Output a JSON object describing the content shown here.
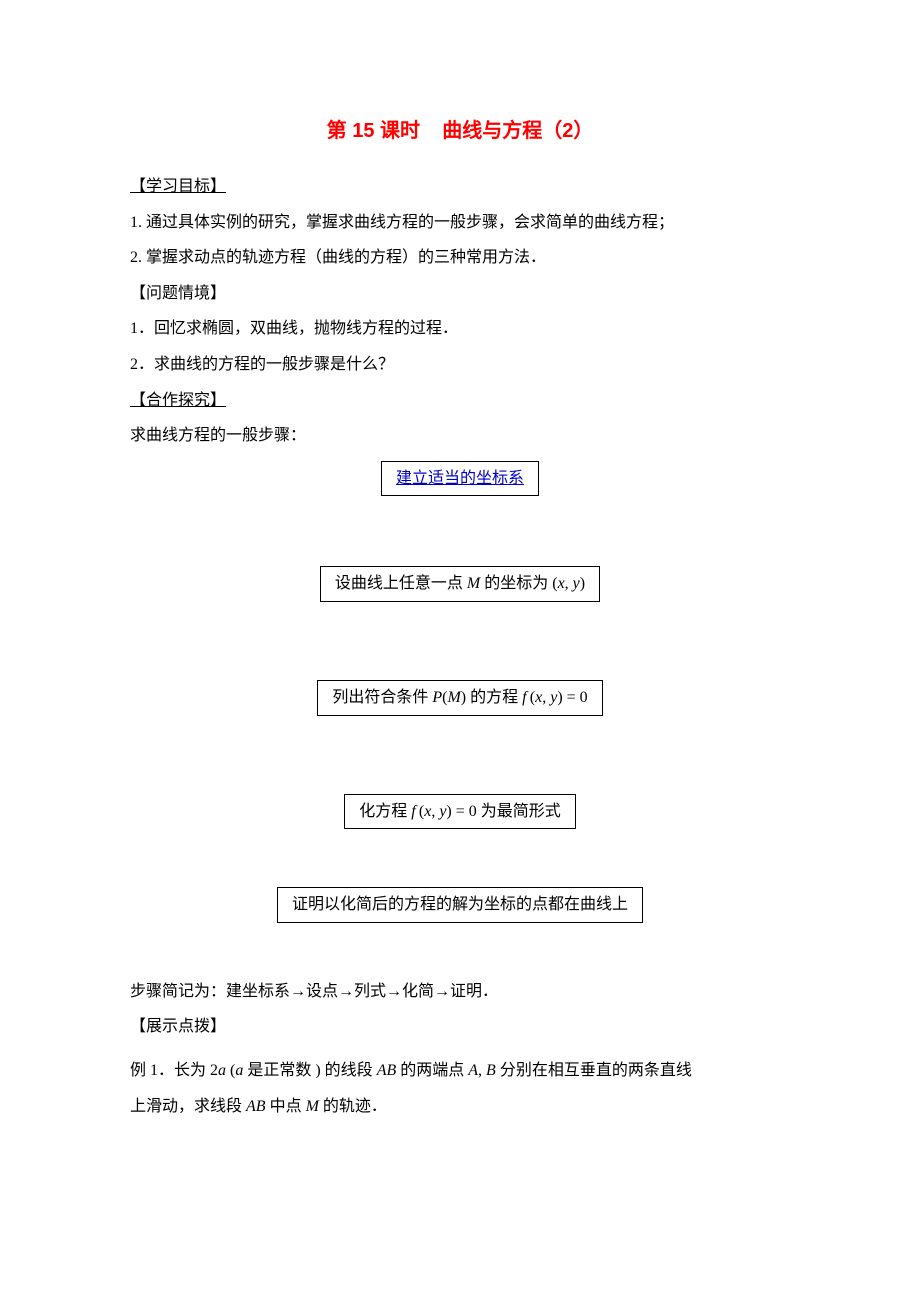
{
  "title_prefix": "第 15 课时",
  "title_main": "曲线与方程（2）",
  "headings": {
    "objectives": "【学习目标】",
    "situation": "【问题情境】",
    "coop": "【合作探究】",
    "demo": "【展示点拨】"
  },
  "objectives": {
    "item1": "1. 通过具体实例的研究，掌握求曲线方程的一般步骤，会求简单的曲线方程；",
    "item2": "2. 掌握求动点的轨迹方程（曲线的方程）的三种常用方法．"
  },
  "situation": {
    "item1": "1．回忆求椭圆，双曲线，抛物线方程的过程．",
    "item2": "2．求曲线的方程的一般步骤是什么？"
  },
  "coop_intro": "求曲线方程的一般步骤：",
  "flow": {
    "step1": "建立适当的坐标系",
    "step2_pre": "设曲线上任意一点 ",
    "step2_mid": " 的坐标为 (",
    "step2_xy_x": "x",
    "step2_xy_sep": ", ",
    "step2_xy_y": "y",
    "step2_end": ")",
    "step3_pre": "列出符合条件 ",
    "step3_pm_p": "P",
    "step3_pm_open": "(",
    "step3_pm_m": "M",
    "step3_pm_close": ")",
    "step3_mid": " 的方程 ",
    "step3_fx": "f",
    "step3_fxy": "(x, y) = 0",
    "step4_pre": "化方程 ",
    "step4_fx": "f",
    "step4_fxy": "(x, y) = 0",
    "step4_post": " 为最简形式",
    "step5": "证明以化简后的方程的解为坐标的点都在曲线上"
  },
  "summary": "步骤简记为：建坐标系→设点→列式→化简→证明．",
  "example1": {
    "prefix": "例 1．长为 ",
    "two_a": "2a",
    "paren_open": " (",
    "a": "a",
    "paren_text": " 是正常数 ) 的线段 ",
    "ab1": "AB",
    "mid1": " 的两端点 ",
    "a_pt": "A",
    "comma": ", ",
    "b_pt": "B",
    "mid2": " 分别在相互垂直的两条直线",
    "line2_pre": "上滑动，求线段 ",
    "ab2": "AB",
    "line2_mid": " 中点 ",
    "m_pt": "M",
    "line2_end": " 的轨迹．"
  }
}
